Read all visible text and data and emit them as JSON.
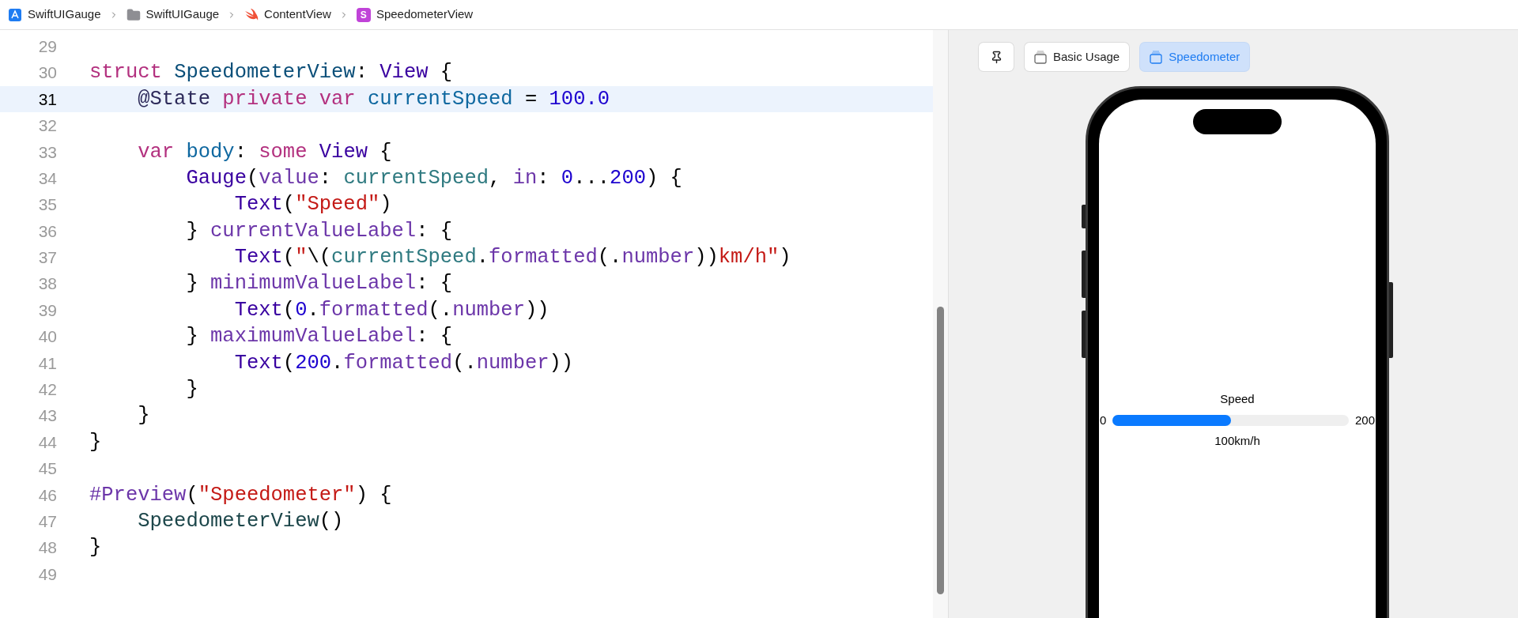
{
  "breadcrumb": [
    {
      "kind": "project",
      "label": "SwiftUIGauge"
    },
    {
      "kind": "folder",
      "label": "SwiftUIGauge"
    },
    {
      "kind": "swift",
      "label": "ContentView"
    },
    {
      "kind": "struct",
      "icon_letter": "S",
      "label": "SpeedometerView"
    }
  ],
  "editor": {
    "lines": [
      {
        "number": "29",
        "selected": false
      },
      {
        "number": "30",
        "selected": false,
        "tokens": [
          {
            "kind": "keyword",
            "text": "struct"
          },
          {
            "kind": "type_decl",
            "text": " SpeedometerView"
          },
          {
            "kind": "plain",
            "text": ": "
          },
          {
            "kind": "type",
            "text": "View"
          },
          {
            "kind": "plain",
            "text": " {"
          }
        ]
      },
      {
        "number": "31",
        "selected": true,
        "tokens": [
          {
            "kind": "attribute",
            "text": "    @State"
          },
          {
            "kind": "keyword",
            "text": " private"
          },
          {
            "kind": "keyword",
            "text": " var"
          },
          {
            "kind": "prop_decl",
            "text": " currentSpeed"
          },
          {
            "kind": "plain",
            "text": " = "
          },
          {
            "kind": "number",
            "text": "100.0"
          }
        ]
      },
      {
        "number": "32",
        "selected": false
      },
      {
        "number": "33",
        "selected": false,
        "tokens": [
          {
            "kind": "keyword",
            "text": "    var"
          },
          {
            "kind": "prop_decl",
            "text": " body"
          },
          {
            "kind": "plain",
            "text": ": "
          },
          {
            "kind": "keyword",
            "text": "some"
          },
          {
            "kind": "type",
            "text": " View"
          },
          {
            "kind": "plain",
            "text": " {"
          }
        ]
      },
      {
        "number": "34",
        "selected": false,
        "tokens": [
          {
            "kind": "type",
            "text": "        Gauge"
          },
          {
            "kind": "plain",
            "text": "("
          },
          {
            "kind": "method",
            "text": "value"
          },
          {
            "kind": "plain",
            "text": ": "
          },
          {
            "kind": "prop",
            "text": "currentSpeed"
          },
          {
            "kind": "plain",
            "text": ", "
          },
          {
            "kind": "method",
            "text": "in"
          },
          {
            "kind": "plain",
            "text": ": "
          },
          {
            "kind": "number",
            "text": "0"
          },
          {
            "kind": "plain",
            "text": "..."
          },
          {
            "kind": "number",
            "text": "200"
          },
          {
            "kind": "plain",
            "text": ") {"
          }
        ]
      },
      {
        "number": "35",
        "selected": false,
        "tokens": [
          {
            "kind": "type",
            "text": "            Text"
          },
          {
            "kind": "plain",
            "text": "("
          },
          {
            "kind": "string",
            "text": "\"Speed\""
          },
          {
            "kind": "plain",
            "text": ")"
          }
        ]
      },
      {
        "number": "36",
        "selected": false,
        "tokens": [
          {
            "kind": "plain",
            "text": "        } "
          },
          {
            "kind": "method",
            "text": "currentValueLabel"
          },
          {
            "kind": "plain",
            "text": ": {"
          }
        ]
      },
      {
        "number": "37",
        "selected": false,
        "tokens": [
          {
            "kind": "type",
            "text": "            Text"
          },
          {
            "kind": "plain",
            "text": "("
          },
          {
            "kind": "string",
            "text": "\""
          },
          {
            "kind": "plain",
            "text": "\\("
          },
          {
            "kind": "prop",
            "text": "currentSpeed"
          },
          {
            "kind": "plain",
            "text": "."
          },
          {
            "kind": "method",
            "text": "formatted"
          },
          {
            "kind": "plain",
            "text": "(."
          },
          {
            "kind": "method",
            "text": "number"
          },
          {
            "kind": "plain",
            "text": "))"
          },
          {
            "kind": "string",
            "text": "km/h\""
          },
          {
            "kind": "plain",
            "text": ")"
          }
        ]
      },
      {
        "number": "38",
        "selected": false,
        "tokens": [
          {
            "kind": "plain",
            "text": "        } "
          },
          {
            "kind": "method",
            "text": "minimumValueLabel"
          },
          {
            "kind": "plain",
            "text": ": {"
          }
        ]
      },
      {
        "number": "39",
        "selected": false,
        "tokens": [
          {
            "kind": "type",
            "text": "            Text"
          },
          {
            "kind": "plain",
            "text": "("
          },
          {
            "kind": "number",
            "text": "0"
          },
          {
            "kind": "plain",
            "text": "."
          },
          {
            "kind": "method",
            "text": "formatted"
          },
          {
            "kind": "plain",
            "text": "(."
          },
          {
            "kind": "method",
            "text": "number"
          },
          {
            "kind": "plain",
            "text": "))"
          }
        ]
      },
      {
        "number": "40",
        "selected": false,
        "tokens": [
          {
            "kind": "plain",
            "text": "        } "
          },
          {
            "kind": "method",
            "text": "maximumValueLabel"
          },
          {
            "kind": "plain",
            "text": ": {"
          }
        ]
      },
      {
        "number": "41",
        "selected": false,
        "tokens": [
          {
            "kind": "type",
            "text": "            Text"
          },
          {
            "kind": "plain",
            "text": "("
          },
          {
            "kind": "number",
            "text": "200"
          },
          {
            "kind": "plain",
            "text": "."
          },
          {
            "kind": "method",
            "text": "formatted"
          },
          {
            "kind": "plain",
            "text": "(."
          },
          {
            "kind": "method",
            "text": "number"
          },
          {
            "kind": "plain",
            "text": "))"
          }
        ]
      },
      {
        "number": "42",
        "selected": false,
        "tokens": [
          {
            "kind": "plain",
            "text": "        }"
          }
        ]
      },
      {
        "number": "43",
        "selected": false,
        "tokens": [
          {
            "kind": "plain",
            "text": "    }"
          }
        ]
      },
      {
        "number": "44",
        "selected": false,
        "tokens": [
          {
            "kind": "plain",
            "text": "}"
          }
        ]
      },
      {
        "number": "45",
        "selected": false
      },
      {
        "number": "46",
        "selected": false,
        "tokens": [
          {
            "kind": "macro",
            "text": "#Preview"
          },
          {
            "kind": "plain",
            "text": "("
          },
          {
            "kind": "string",
            "text": "\"Speedometer\""
          },
          {
            "kind": "plain",
            "text": ") {"
          }
        ]
      },
      {
        "number": "47",
        "selected": false,
        "tokens": [
          {
            "kind": "type_use",
            "text": "    SpeedometerView"
          },
          {
            "kind": "plain",
            "text": "()"
          }
        ]
      },
      {
        "number": "48",
        "selected": false,
        "tokens": [
          {
            "kind": "plain",
            "text": "}"
          }
        ]
      },
      {
        "number": "49",
        "selected": false
      }
    ]
  },
  "preview": {
    "tabs": [
      {
        "label": "Basic Usage",
        "selected": false
      },
      {
        "label": "Speedometer",
        "selected": true
      }
    ],
    "gauge": {
      "label": "Speed",
      "minimum": "0",
      "maximum": "200",
      "current": "100km/h",
      "level": 0.5
    }
  }
}
